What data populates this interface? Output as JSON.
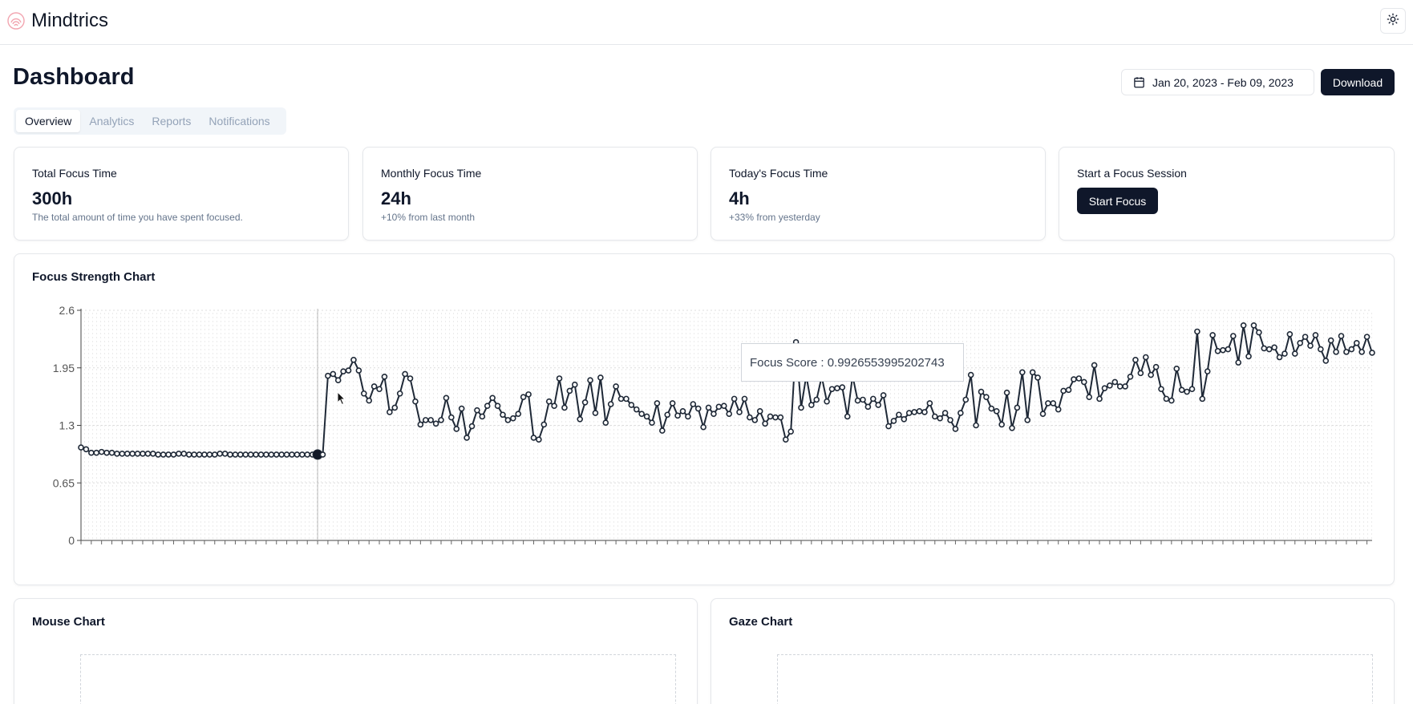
{
  "app": {
    "brand": "Mindtrics"
  },
  "header": {
    "title": "Dashboard"
  },
  "date_range": "Jan 20, 2023 - Feb 09, 2023",
  "download_label": "Download",
  "tabs": [
    "Overview",
    "Analytics",
    "Reports",
    "Notifications"
  ],
  "stats": [
    {
      "label": "Total Focus Time",
      "value": "300h",
      "sub": "The total amount of time you have spent focused."
    },
    {
      "label": "Monthly Focus Time",
      "value": "24h",
      "sub": "+10% from last month"
    },
    {
      "label": "Today's Focus Time",
      "value": "4h",
      "sub": "+33% from yesterday"
    }
  ],
  "session": {
    "label": "Start a Focus Session",
    "button": "Start Focus"
  },
  "focus_chart": {
    "title": "Focus Strength Chart",
    "tooltip": "Focus Score : 0.9926553995202743"
  },
  "mouse_chart": {
    "title": "Mouse Chart"
  },
  "gaze_chart": {
    "title": "Gaze Chart"
  },
  "colors": {
    "primary": "#0f172a",
    "brand_icon": "#f2a5b0",
    "muted": "#64748b"
  },
  "chart_data": {
    "type": "line",
    "title": "Focus Strength Chart",
    "ylim": [
      0,
      2.6
    ],
    "yticks": [
      "0",
      "0.65",
      "1.3",
      "1.95",
      "2.6"
    ],
    "grid": true,
    "active_index": 46,
    "values": [
      1.05,
      1.03,
      0.99,
      0.99,
      1.0,
      0.99,
      0.99,
      0.98,
      0.98,
      0.98,
      0.98,
      0.98,
      0.98,
      0.98,
      0.98,
      0.97,
      0.97,
      0.97,
      0.97,
      0.98,
      0.98,
      0.97,
      0.97,
      0.97,
      0.97,
      0.97,
      0.97,
      0.98,
      0.98,
      0.97,
      0.97,
      0.97,
      0.97,
      0.97,
      0.97,
      0.97,
      0.97,
      0.97,
      0.97,
      0.97,
      0.97,
      0.97,
      0.97,
      0.97,
      0.97,
      0.97,
      0.97,
      0.97,
      1.86,
      1.88,
      1.81,
      1.91,
      1.92,
      2.04,
      1.92,
      1.66,
      1.58,
      1.74,
      1.71,
      1.85,
      1.45,
      1.5,
      1.66,
      1.88,
      1.83,
      1.57,
      1.31,
      1.36,
      1.36,
      1.32,
      1.36,
      1.61,
      1.39,
      1.26,
      1.49,
      1.16,
      1.29,
      1.47,
      1.4,
      1.52,
      1.61,
      1.52,
      1.42,
      1.36,
      1.38,
      1.43,
      1.62,
      1.65,
      1.16,
      1.14,
      1.31,
      1.57,
      1.52,
      1.83,
      1.5,
      1.69,
      1.76,
      1.37,
      1.56,
      1.81,
      1.44,
      1.84,
      1.33,
      1.54,
      1.74,
      1.6,
      1.6,
      1.53,
      1.48,
      1.43,
      1.4,
      1.33,
      1.55,
      1.24,
      1.42,
      1.55,
      1.41,
      1.46,
      1.4,
      1.54,
      1.49,
      1.28,
      1.5,
      1.43,
      1.51,
      1.52,
      1.43,
      1.6,
      1.45,
      1.6,
      1.39,
      1.36,
      1.46,
      1.32,
      1.4,
      1.39,
      1.39,
      1.14,
      1.23,
      2.24,
      1.5,
      1.86,
      1.53,
      1.59,
      1.85,
      1.57,
      1.71,
      1.72,
      1.73,
      1.4,
      1.86,
      1.58,
      1.59,
      1.51,
      1.6,
      1.53,
      1.64,
      1.29,
      1.35,
      1.42,
      1.37,
      1.44,
      1.45,
      1.46,
      1.45,
      1.55,
      1.4,
      1.38,
      1.44,
      1.36,
      1.26,
      1.44,
      1.59,
      1.87,
      1.3,
      1.68,
      1.62,
      1.49,
      1.46,
      1.31,
      1.67,
      1.27,
      1.5,
      1.9,
      1.36,
      1.9,
      1.84,
      1.43,
      1.55,
      1.55,
      1.48,
      1.69,
      1.7,
      1.82,
      1.83,
      1.79,
      1.62,
      1.98,
      1.6,
      1.72,
      1.75,
      1.79,
      1.74,
      1.74,
      1.85,
      2.04,
      1.89,
      2.07,
      1.87,
      1.96,
      1.71,
      1.6,
      1.58,
      1.94,
      1.7,
      1.68,
      1.71,
      2.36,
      1.6,
      1.91,
      2.32,
      2.14,
      2.15,
      2.16,
      2.31,
      2.01,
      2.43,
      2.08,
      2.43,
      2.35,
      2.17,
      2.16,
      2.18,
      2.07,
      2.11,
      2.33,
      2.11,
      2.23,
      2.3,
      2.2,
      2.32,
      2.16,
      2.03,
      2.26,
      2.13,
      2.31,
      2.13,
      2.16,
      2.23,
      2.13,
      2.3,
      2.12
    ]
  }
}
